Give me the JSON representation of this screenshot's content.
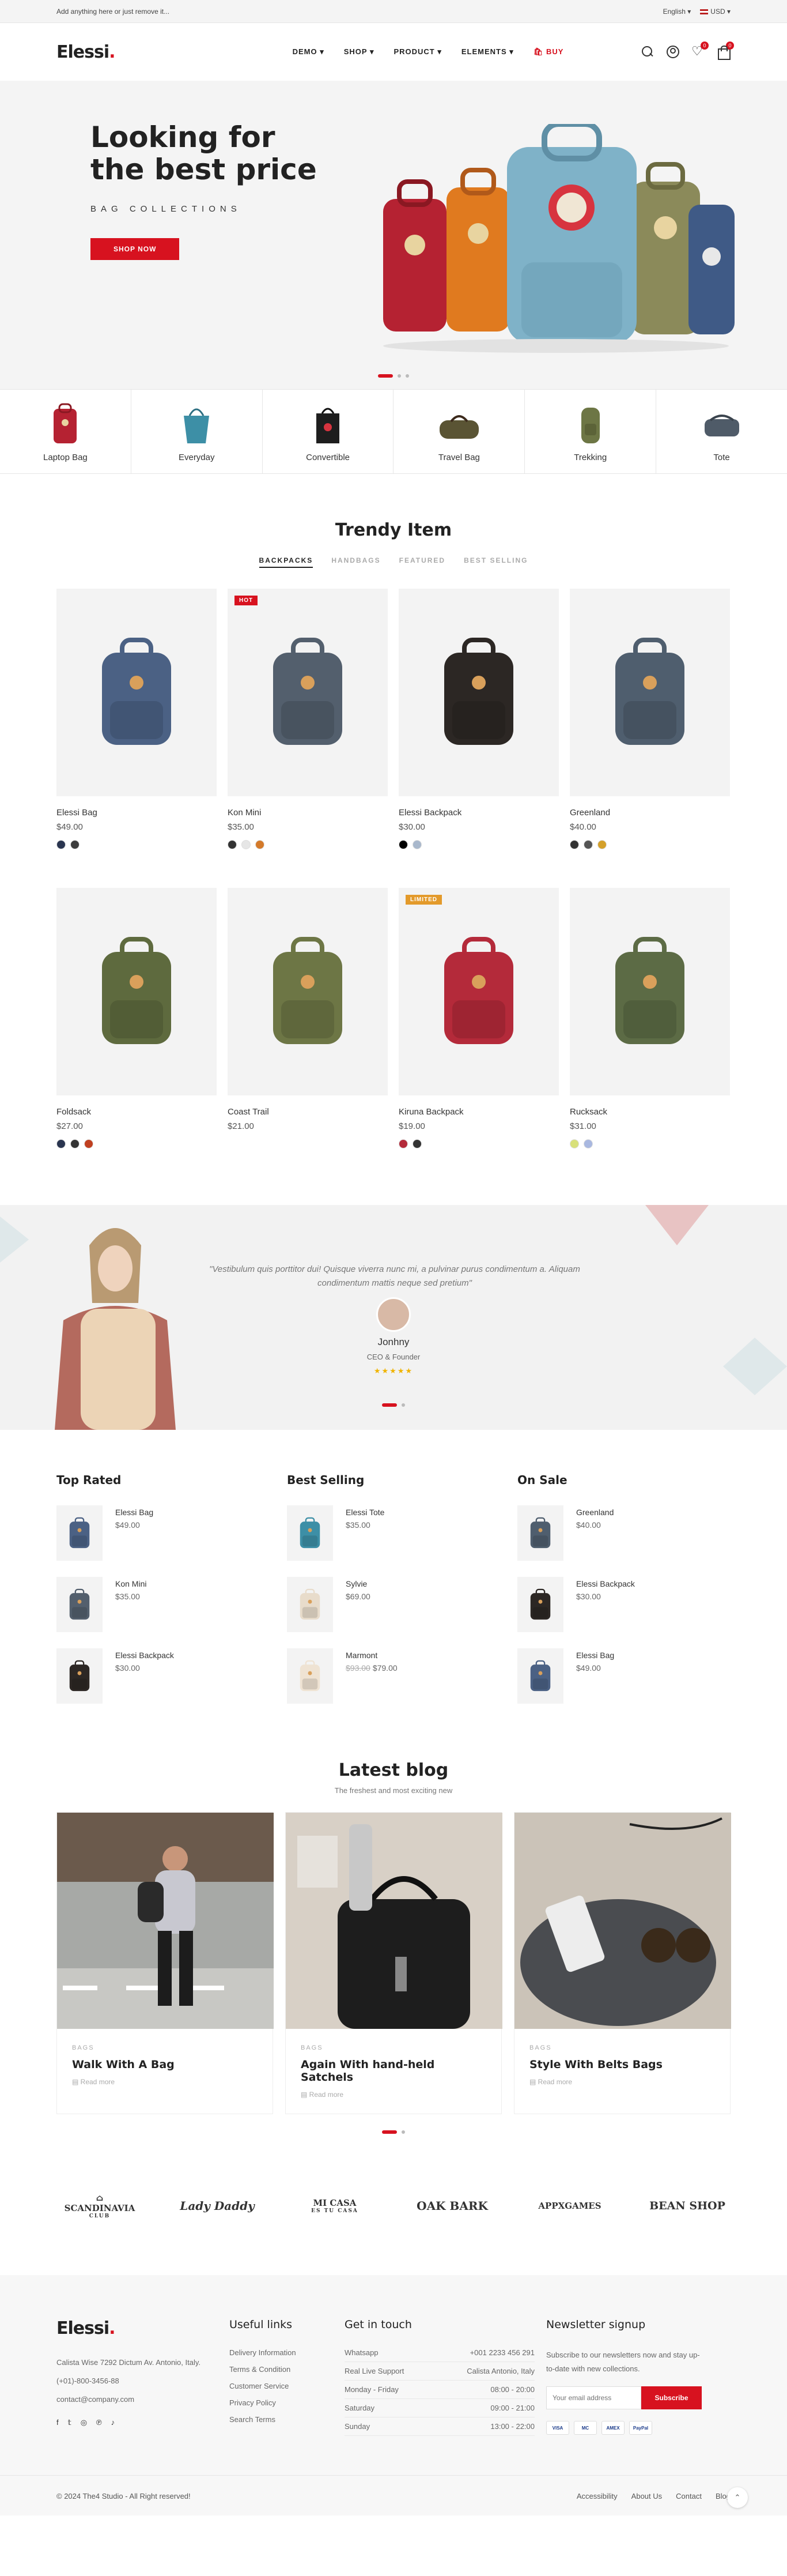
{
  "topbar": {
    "promo": "Add anything here or just remove it...",
    "language": "English",
    "currency": "USD"
  },
  "header": {
    "logo": "Elessi",
    "nav": [
      "DEMO",
      "SHOP",
      "PRODUCT",
      "ELEMENTS",
      "BUY"
    ],
    "wishlist_count": "0",
    "cart_count": "0"
  },
  "hero": {
    "title": "Looking for the best price",
    "subtitle": "BAG COLLECTIONS",
    "button": "SHOP NOW"
  },
  "categories": [
    "Laptop Bag",
    "Everyday",
    "Convertible",
    "Travel Bag",
    "Trekking",
    "Tote"
  ],
  "trendy": {
    "title": "Trendy Item",
    "tabs": [
      "BACKPACKS",
      "HANDBAGS",
      "FEATURED",
      "BEST SELLING"
    ],
    "products": [
      {
        "name": "Elessi Bag",
        "price": "$49.00",
        "tag": "",
        "color": "#4b6184",
        "swatches": [
          "#2a3550",
          "#3d3d3d"
        ]
      },
      {
        "name": "Kon Mini",
        "price": "$35.00",
        "tag": "HOT",
        "color": "#535f6d",
        "swatches": [
          "#333",
          "#e6e6e6",
          "#d47a2a"
        ]
      },
      {
        "name": "Elessi Backpack",
        "price": "$30.00",
        "tag": "",
        "color": "#2c2724",
        "swatches": [
          "#000000",
          "#a9b8cc"
        ]
      },
      {
        "name": "Greenland",
        "price": "$40.00",
        "tag": "",
        "color": "#4f5e6e",
        "swatches": [
          "#333",
          "#555",
          "#d4a02a"
        ]
      },
      {
        "name": "Foldsack",
        "price": "$27.00",
        "tag": "",
        "color": "#5e6a3e",
        "swatches": [
          "#2a3550",
          "#333",
          "#c04020"
        ]
      },
      {
        "name": "Coast Trail",
        "price": "$21.00",
        "tag": "",
        "color": "#6d7645",
        "swatches": []
      },
      {
        "name": "Kiruna Backpack",
        "price": "$19.00",
        "tag": "LIMITED",
        "color": "#b42a3a",
        "swatches": [
          "#b42a3a",
          "#333"
        ]
      },
      {
        "name": "Rucksack",
        "price": "$31.00",
        "tag": "",
        "color": "#5c6b45",
        "swatches": [
          "#d8e07a",
          "#a9b8e0"
        ]
      }
    ]
  },
  "testimonial": {
    "quote": "\"Vestibulum quis porttitor dui! Quisque viverra nunc mi, a pulvinar purus condimentum a. Aliquam condimentum mattis neque sed pretium\"",
    "name": "Jonhny",
    "role": "CEO & Founder",
    "stars": "★★★★★"
  },
  "lists": [
    {
      "title": "Top Rated",
      "items": [
        {
          "name": "Elessi Bag",
          "price": "$49.00",
          "old": "",
          "color": "#4b6184"
        },
        {
          "name": "Kon Mini",
          "price": "$35.00",
          "old": "",
          "color": "#535f6d"
        },
        {
          "name": "Elessi Backpack",
          "price": "$30.00",
          "old": "",
          "color": "#2c2724"
        }
      ]
    },
    {
      "title": "Best Selling",
      "items": [
        {
          "name": "Elessi Tote",
          "price": "$35.00",
          "old": "",
          "color": "#3d8fa6"
        },
        {
          "name": "Sylvie",
          "price": "$69.00",
          "old": "",
          "color": "#e8dccb"
        },
        {
          "name": "Marmont",
          "price": "$79.00",
          "old": "$93.00",
          "color": "#efe3d3"
        }
      ]
    },
    {
      "title": "On Sale",
      "items": [
        {
          "name": "Greenland",
          "price": "$40.00",
          "old": "",
          "color": "#4f5e6e"
        },
        {
          "name": "Elessi Backpack",
          "price": "$30.00",
          "old": "",
          "color": "#2c2724"
        },
        {
          "name": "Elessi Bag",
          "price": "$49.00",
          "old": "",
          "color": "#4b6184"
        }
      ]
    }
  ],
  "blog": {
    "title": "Latest blog",
    "subtitle": "The freshest and most exciting new",
    "posts": [
      {
        "cat": "BAGS",
        "title": "Walk With A Bag",
        "more": "Read more"
      },
      {
        "cat": "BAGS",
        "title": "Again With hand-held Satchels",
        "more": "Read more"
      },
      {
        "cat": "BAGS",
        "title": "Style With Belts Bags",
        "more": "Read more"
      }
    ]
  },
  "brands": [
    {
      "name": "SCANDINAVIA",
      "sub": "CLUB"
    },
    {
      "name": "Lady Daddy",
      "sub": ""
    },
    {
      "name": "MI CASA",
      "sub": "ES TU CASA"
    },
    {
      "name": "OAK BARK",
      "sub": ""
    },
    {
      "name": "APPXGAMES",
      "sub": ""
    },
    {
      "name": "BEAN SHOP",
      "sub": ""
    }
  ],
  "footer": {
    "logo": "Elessi",
    "address": "Calista Wise 7292 Dictum Av. Antonio, Italy.",
    "phone": "(+01)-800-3456-88",
    "email": "contact@company.com",
    "useful_title": "Useful links",
    "useful_links": [
      "Delivery Information",
      "Terms & Condition",
      "Customer Service",
      "Privacy Policy",
      "Search Terms"
    ],
    "touch_title": "Get in touch",
    "hours": [
      {
        "k": "Whatsapp",
        "v": "+001 2233 456 291"
      },
      {
        "k": "Real Live Support",
        "v": "Calista Antonio, Italy"
      },
      {
        "k": "Monday - Friday",
        "v": "08:00 - 20:00"
      },
      {
        "k": "Saturday",
        "v": "09:00 - 21:00"
      },
      {
        "k": "Sunday",
        "v": "13:00 - 22:00"
      }
    ],
    "news_title": "Newsletter signup",
    "news_text": "Subscribe to our newsletters now and stay up-to-date with new collections.",
    "email_placeholder": "Your email address",
    "subscribe": "Subscribe",
    "payments": [
      "VISA",
      "MC",
      "AMEX",
      "PayPal"
    ],
    "copyright": "© 2024 The4 Studio - All Right reserved!",
    "bottom_links": [
      "Accessibility",
      "About Us",
      "Contact",
      "Blog"
    ]
  },
  "colors": {
    "accent": "#d7121f"
  }
}
